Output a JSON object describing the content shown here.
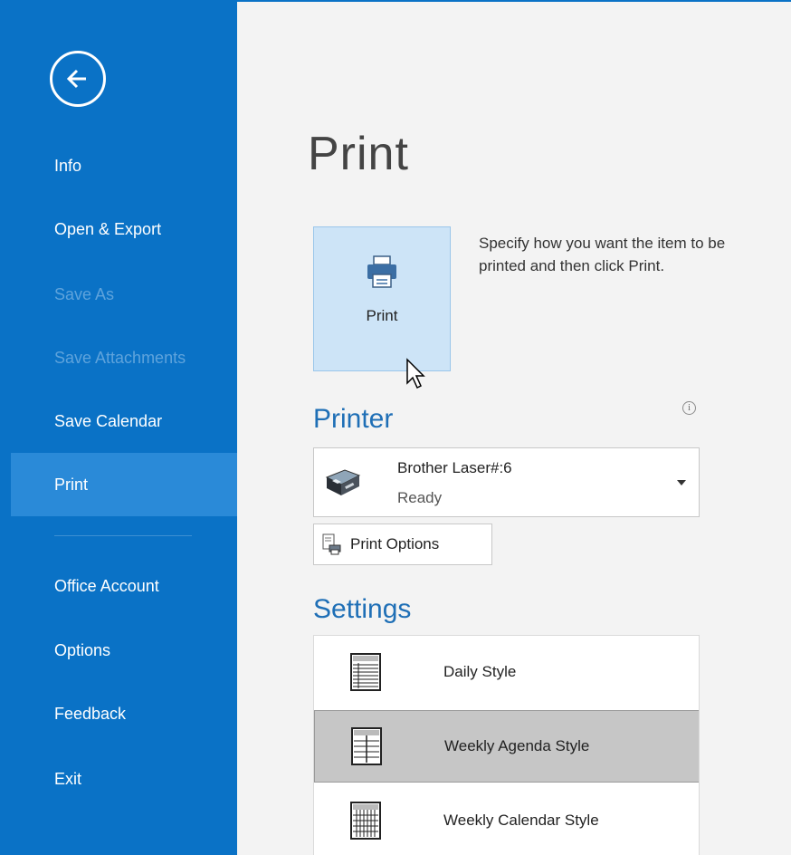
{
  "sidebar": {
    "items": [
      {
        "label": "Info"
      },
      {
        "label": "Open & Export"
      },
      {
        "label": "Save As"
      },
      {
        "label": "Save Attachments"
      },
      {
        "label": "Save Calendar"
      },
      {
        "label": "Print"
      },
      {
        "label": "Office Account"
      },
      {
        "label": "Options"
      },
      {
        "label": "Feedback"
      },
      {
        "label": "Exit"
      }
    ],
    "active": "Print",
    "disabled": [
      "Save As",
      "Save Attachments"
    ],
    "bg_color": "#0a72c6",
    "active_color": "#2a8ad8"
  },
  "main": {
    "title": "Print",
    "print_button_label": "Print",
    "description": "Specify how you want the item to be printed and then click Print.",
    "printer_heading": "Printer",
    "info_icon": "i",
    "printer": {
      "name": "Brother Laser#:6",
      "status": "Ready"
    },
    "print_options_label": "Print Options",
    "settings_heading": "Settings",
    "styles": [
      {
        "label": "Daily Style",
        "icon": "daily-style-icon"
      },
      {
        "label": "Weekly Agenda Style",
        "icon": "weekly-agenda-style-icon",
        "selected": true
      },
      {
        "label": "Weekly Calendar Style",
        "icon": "weekly-calendar-style-icon"
      }
    ],
    "heading_color": "#1f6fb6",
    "selected_color": "#c6c6c6"
  }
}
